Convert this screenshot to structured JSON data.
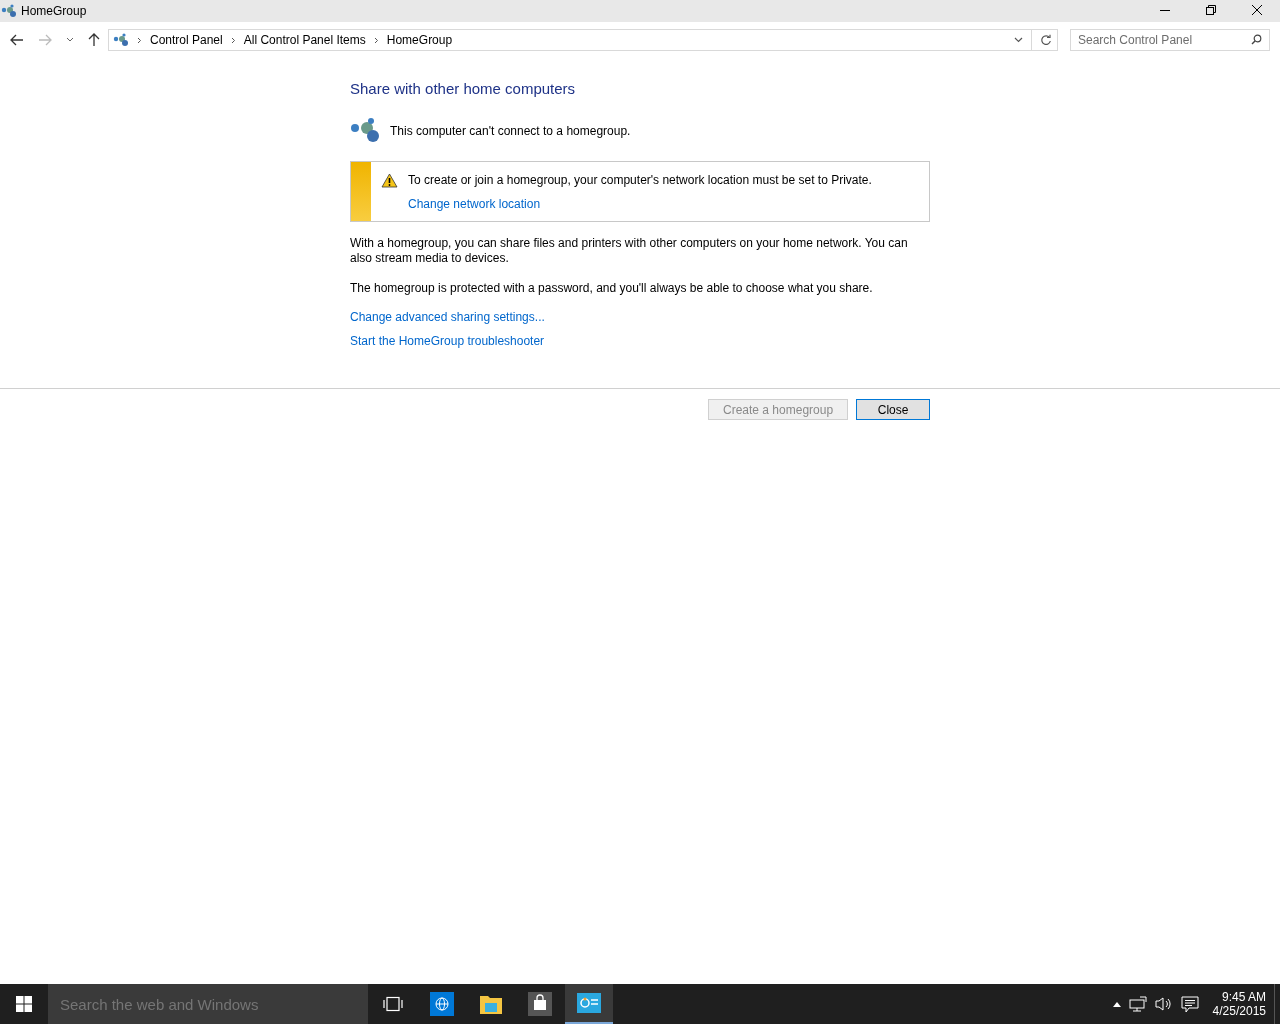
{
  "window": {
    "title": "HomeGroup"
  },
  "address_bar": {
    "breadcrumbs": [
      "Control Panel",
      "All Control Panel Items",
      "HomeGroup"
    ]
  },
  "search": {
    "placeholder": "Search Control Panel"
  },
  "content": {
    "heading": "Share with other home computers",
    "status": "This computer can't connect to a homegroup.",
    "warning": {
      "message": "To create or join a homegroup, your computer's network location must be set to Private.",
      "link": "Change network location"
    },
    "paragraphs": [
      "With a homegroup, you can share files and printers with other computers on your home network. You can also stream media to devices.",
      "The homegroup is protected with a password, and you'll always be able to choose what you share."
    ],
    "links": [
      "Change advanced sharing settings...",
      "Start the HomeGroup troubleshooter"
    ]
  },
  "buttons": [
    {
      "label": "Create a homegroup",
      "disabled": true
    },
    {
      "label": "Close",
      "disabled": false
    }
  ],
  "taskbar": {
    "search_placeholder": "Search the web and Windows",
    "apps": [
      {
        "kind": "task-view",
        "selected": false
      },
      {
        "kind": "browser",
        "selected": false
      },
      {
        "kind": "folder",
        "selected": false
      },
      {
        "kind": "store",
        "selected": false
      },
      {
        "kind": "control-panel",
        "selected": true
      }
    ],
    "time": "9:45 AM",
    "date": "4/25/2015"
  }
}
